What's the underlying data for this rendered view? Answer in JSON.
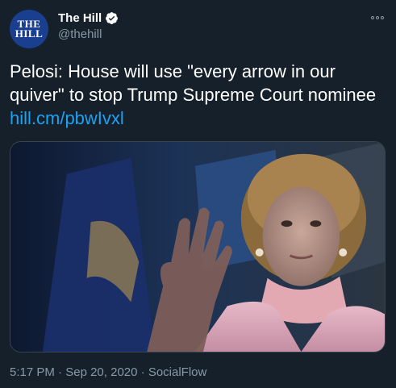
{
  "author": {
    "display_name": "The Hill",
    "handle": "@thehill",
    "avatar_text": "THE\nHILL",
    "verified": true
  },
  "tweet": {
    "text": "Pelosi: House will use \"every arrow in our quiver\" to stop Trump Supreme Court nominee ",
    "link_text": "hill.cm/pbwIvxl"
  },
  "media": {
    "icon": "photo-of-speaker-icon"
  },
  "meta": {
    "time": "5:17 PM",
    "separator1": " · ",
    "date": "Sep 20, 2020",
    "separator2": " · ",
    "source": "SocialFlow"
  },
  "colors": {
    "background": "#15202b",
    "link": "#1da1f2",
    "secondary_text": "#8899a6",
    "avatar_bg": "#1a3f8f"
  }
}
